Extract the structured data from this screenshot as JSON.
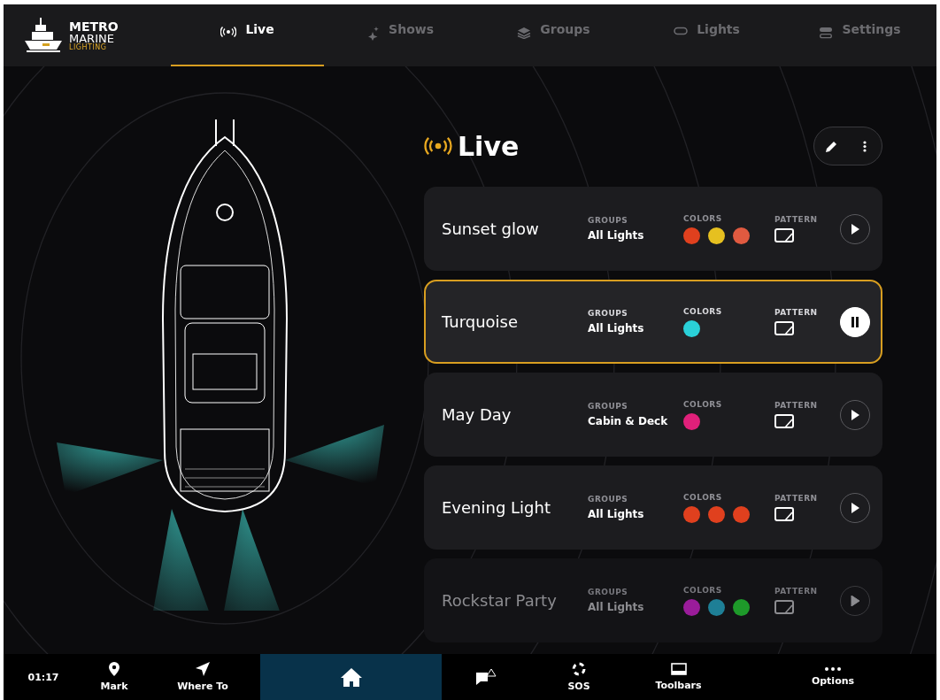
{
  "brand": {
    "line1": "METRO",
    "line2": "MARINE",
    "line3": "LIGHTING"
  },
  "tabs": [
    {
      "label": "Live",
      "selected": true
    },
    {
      "label": "Shows",
      "selected": false
    },
    {
      "label": "Groups",
      "selected": false
    },
    {
      "label": "Lights",
      "selected": false
    },
    {
      "label": "Settings",
      "selected": false
    }
  ],
  "panel": {
    "title": "Live"
  },
  "shows": [
    {
      "name": "Sunset glow",
      "labels": [
        "GROUPS",
        "COLORS",
        "PATTERN"
      ],
      "group": "All Lights",
      "colors": [
        {
          "color": "#e0401e"
        },
        {
          "color": "#e6c020"
        },
        {
          "color": "#e05a40"
        }
      ],
      "selected": false,
      "disabled": false
    },
    {
      "name": "Turquoise",
      "labels": [
        "GROUPS",
        "COLORS",
        "PATTERN"
      ],
      "group": "All Lights",
      "colors": [
        {
          "color": "#2ad0d8"
        }
      ],
      "selected": true,
      "disabled": false
    },
    {
      "name": "May Day",
      "labels": [
        "GROUPS",
        "COLORS",
        "PATTERN"
      ],
      "group": "Cabin & Deck",
      "colors": [
        {
          "color": "#e0207a"
        }
      ],
      "selected": false,
      "disabled": false
    },
    {
      "name": "Evening Light",
      "labels": [
        "GROUPS",
        "COLORS",
        "PATTERN"
      ],
      "group": "All Lights",
      "colors": [
        {
          "color": "#e0401e"
        },
        {
          "color": "#e0401e"
        },
        {
          "color": "#e0401e"
        }
      ],
      "selected": false,
      "disabled": false
    },
    {
      "name": "Rockstar Party",
      "labels": [
        "GROUPS",
        "COLORS",
        "PATTERN"
      ],
      "group": "All Lights",
      "colors": [
        {
          "color": "#9a1c9a"
        },
        {
          "color": "#1e7f96"
        },
        {
          "color": "#1e9a2a"
        }
      ],
      "selected": false,
      "disabled": true
    }
  ],
  "bottom_bar": [
    {
      "kind": "time",
      "label": "01:17"
    },
    {
      "kind": "pin",
      "label": "Mark",
      "selected": false
    },
    {
      "kind": "arrow",
      "label": "Where To",
      "selected": false
    },
    {
      "kind": "home",
      "selected": true
    },
    {
      "kind": "message",
      "selected": false
    },
    {
      "kind": "lifebuoy",
      "label": "SOS",
      "selected": false
    },
    {
      "kind": "toolbar",
      "label": "Toolbars",
      "selected": false
    },
    {
      "kind": "dots",
      "label": "Options",
      "selected": false
    }
  ]
}
